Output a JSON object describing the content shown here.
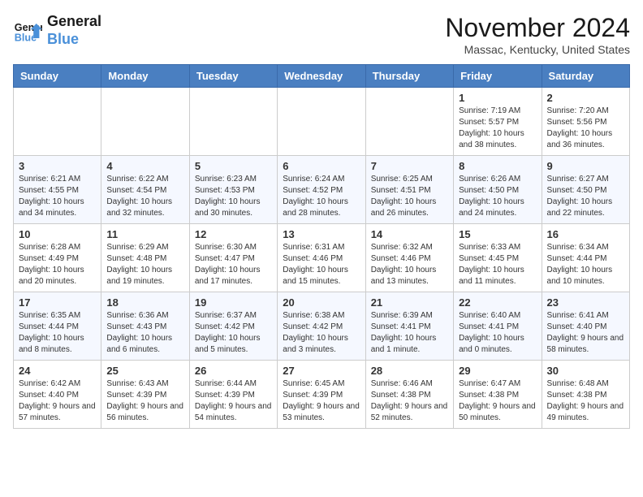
{
  "header": {
    "logo_line1": "General",
    "logo_line2": "Blue",
    "month_title": "November 2024",
    "location": "Massac, Kentucky, United States"
  },
  "weekdays": [
    "Sunday",
    "Monday",
    "Tuesday",
    "Wednesday",
    "Thursday",
    "Friday",
    "Saturday"
  ],
  "weeks": [
    [
      {
        "day": "",
        "info": ""
      },
      {
        "day": "",
        "info": ""
      },
      {
        "day": "",
        "info": ""
      },
      {
        "day": "",
        "info": ""
      },
      {
        "day": "",
        "info": ""
      },
      {
        "day": "1",
        "info": "Sunrise: 7:19 AM\nSunset: 5:57 PM\nDaylight: 10 hours and 38 minutes."
      },
      {
        "day": "2",
        "info": "Sunrise: 7:20 AM\nSunset: 5:56 PM\nDaylight: 10 hours and 36 minutes."
      }
    ],
    [
      {
        "day": "3",
        "info": "Sunrise: 6:21 AM\nSunset: 4:55 PM\nDaylight: 10 hours and 34 minutes."
      },
      {
        "day": "4",
        "info": "Sunrise: 6:22 AM\nSunset: 4:54 PM\nDaylight: 10 hours and 32 minutes."
      },
      {
        "day": "5",
        "info": "Sunrise: 6:23 AM\nSunset: 4:53 PM\nDaylight: 10 hours and 30 minutes."
      },
      {
        "day": "6",
        "info": "Sunrise: 6:24 AM\nSunset: 4:52 PM\nDaylight: 10 hours and 28 minutes."
      },
      {
        "day": "7",
        "info": "Sunrise: 6:25 AM\nSunset: 4:51 PM\nDaylight: 10 hours and 26 minutes."
      },
      {
        "day": "8",
        "info": "Sunrise: 6:26 AM\nSunset: 4:50 PM\nDaylight: 10 hours and 24 minutes."
      },
      {
        "day": "9",
        "info": "Sunrise: 6:27 AM\nSunset: 4:50 PM\nDaylight: 10 hours and 22 minutes."
      }
    ],
    [
      {
        "day": "10",
        "info": "Sunrise: 6:28 AM\nSunset: 4:49 PM\nDaylight: 10 hours and 20 minutes."
      },
      {
        "day": "11",
        "info": "Sunrise: 6:29 AM\nSunset: 4:48 PM\nDaylight: 10 hours and 19 minutes."
      },
      {
        "day": "12",
        "info": "Sunrise: 6:30 AM\nSunset: 4:47 PM\nDaylight: 10 hours and 17 minutes."
      },
      {
        "day": "13",
        "info": "Sunrise: 6:31 AM\nSunset: 4:46 PM\nDaylight: 10 hours and 15 minutes."
      },
      {
        "day": "14",
        "info": "Sunrise: 6:32 AM\nSunset: 4:46 PM\nDaylight: 10 hours and 13 minutes."
      },
      {
        "day": "15",
        "info": "Sunrise: 6:33 AM\nSunset: 4:45 PM\nDaylight: 10 hours and 11 minutes."
      },
      {
        "day": "16",
        "info": "Sunrise: 6:34 AM\nSunset: 4:44 PM\nDaylight: 10 hours and 10 minutes."
      }
    ],
    [
      {
        "day": "17",
        "info": "Sunrise: 6:35 AM\nSunset: 4:44 PM\nDaylight: 10 hours and 8 minutes."
      },
      {
        "day": "18",
        "info": "Sunrise: 6:36 AM\nSunset: 4:43 PM\nDaylight: 10 hours and 6 minutes."
      },
      {
        "day": "19",
        "info": "Sunrise: 6:37 AM\nSunset: 4:42 PM\nDaylight: 10 hours and 5 minutes."
      },
      {
        "day": "20",
        "info": "Sunrise: 6:38 AM\nSunset: 4:42 PM\nDaylight: 10 hours and 3 minutes."
      },
      {
        "day": "21",
        "info": "Sunrise: 6:39 AM\nSunset: 4:41 PM\nDaylight: 10 hours and 1 minute."
      },
      {
        "day": "22",
        "info": "Sunrise: 6:40 AM\nSunset: 4:41 PM\nDaylight: 10 hours and 0 minutes."
      },
      {
        "day": "23",
        "info": "Sunrise: 6:41 AM\nSunset: 4:40 PM\nDaylight: 9 hours and 58 minutes."
      }
    ],
    [
      {
        "day": "24",
        "info": "Sunrise: 6:42 AM\nSunset: 4:40 PM\nDaylight: 9 hours and 57 minutes."
      },
      {
        "day": "25",
        "info": "Sunrise: 6:43 AM\nSunset: 4:39 PM\nDaylight: 9 hours and 56 minutes."
      },
      {
        "day": "26",
        "info": "Sunrise: 6:44 AM\nSunset: 4:39 PM\nDaylight: 9 hours and 54 minutes."
      },
      {
        "day": "27",
        "info": "Sunrise: 6:45 AM\nSunset: 4:39 PM\nDaylight: 9 hours and 53 minutes."
      },
      {
        "day": "28",
        "info": "Sunrise: 6:46 AM\nSunset: 4:38 PM\nDaylight: 9 hours and 52 minutes."
      },
      {
        "day": "29",
        "info": "Sunrise: 6:47 AM\nSunset: 4:38 PM\nDaylight: 9 hours and 50 minutes."
      },
      {
        "day": "30",
        "info": "Sunrise: 6:48 AM\nSunset: 4:38 PM\nDaylight: 9 hours and 49 minutes."
      }
    ]
  ]
}
